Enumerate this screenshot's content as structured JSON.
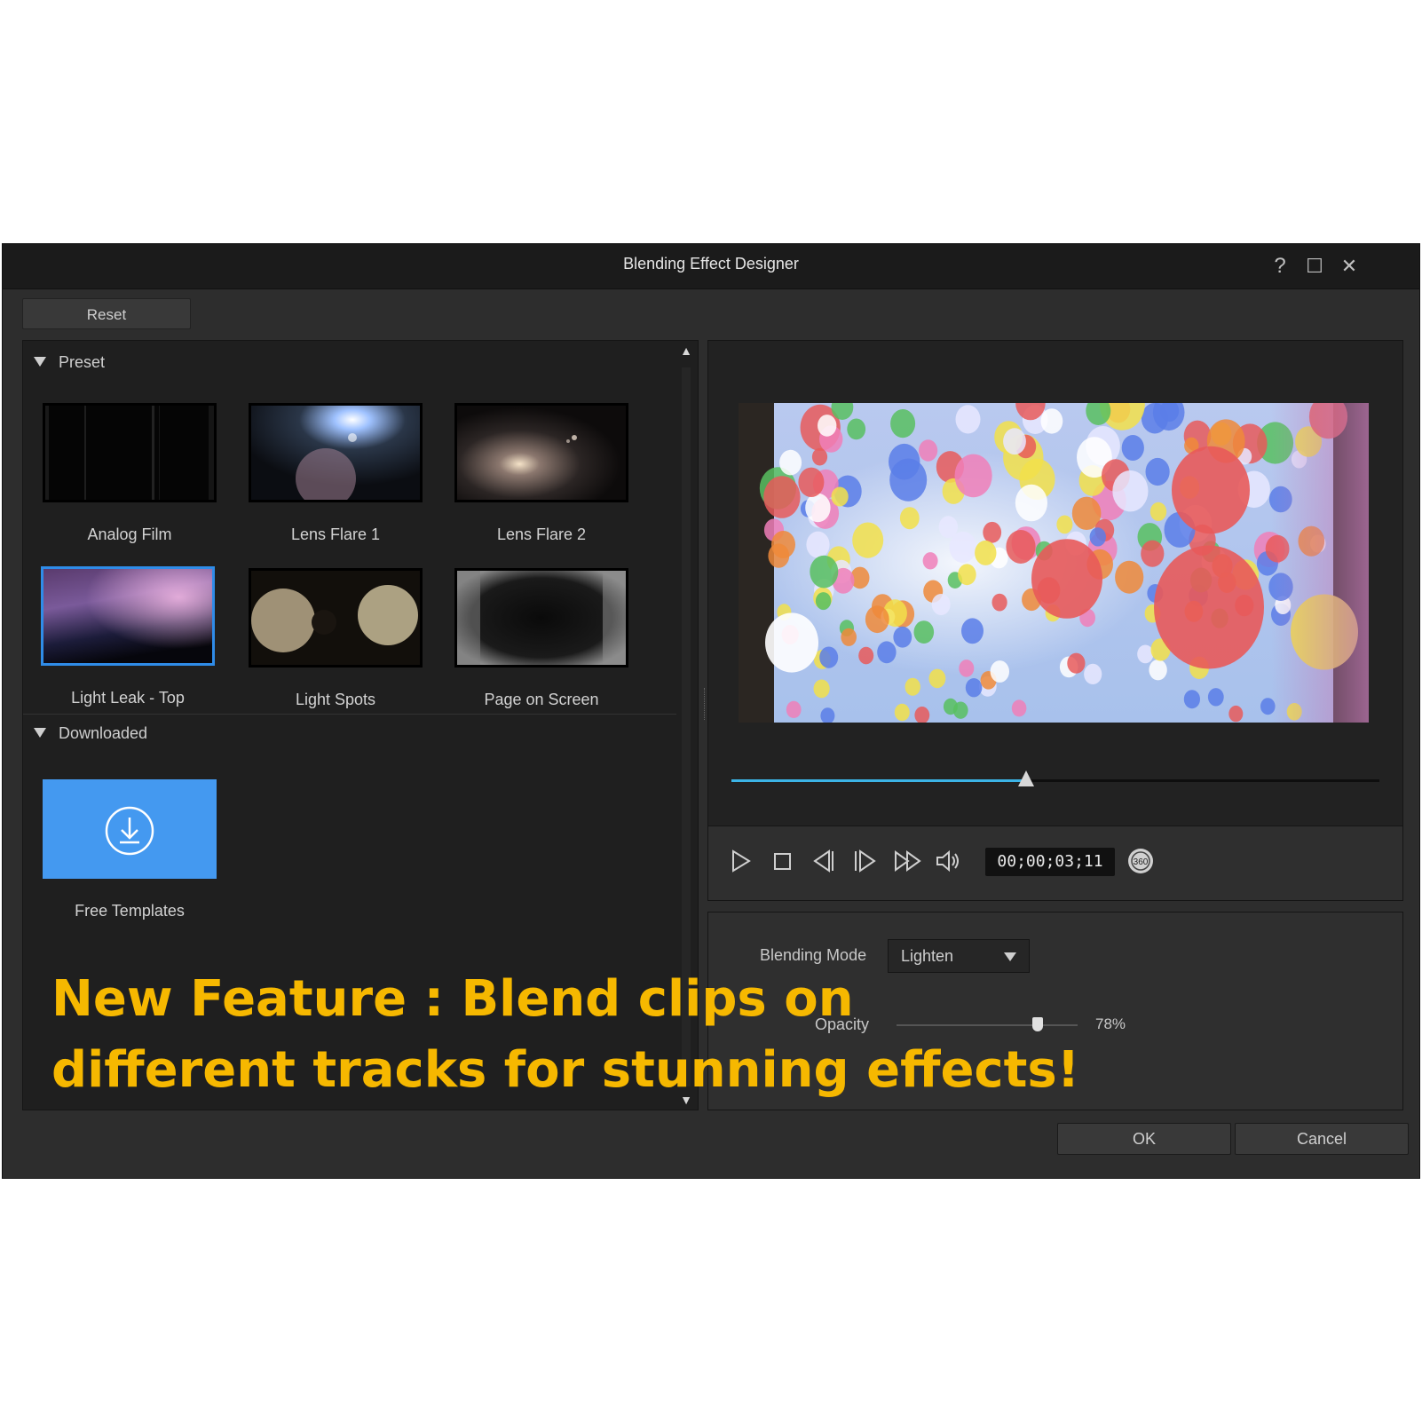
{
  "window": {
    "title": "Blending Effect Designer",
    "help_label": "?",
    "maximize_label": "☐",
    "close_label": "✕"
  },
  "toolbar": {
    "reset_label": "Reset"
  },
  "library": {
    "preset_header": "Preset",
    "presets": [
      {
        "label": "Analog Film"
      },
      {
        "label": "Lens Flare 1"
      },
      {
        "label": "Lens Flare 2"
      },
      {
        "label": "Light Leak - Top",
        "selected": true
      },
      {
        "label": "Light Spots"
      },
      {
        "label": "Page on Screen"
      }
    ],
    "downloaded_header": "Downloaded",
    "downloaded": [
      {
        "label": "Free Templates"
      }
    ],
    "scroll_up": "▲",
    "scroll_down": "▼"
  },
  "player": {
    "progress_fraction": 0.455,
    "timecode": "00;00;03;11",
    "badge_360": "360"
  },
  "settings": {
    "blending_mode_label": "Blending Mode",
    "blending_mode_value": "Lighten",
    "opacity_label": "Opacity",
    "opacity_value": "78%",
    "opacity_fraction": 0.78
  },
  "footer": {
    "ok_label": "OK",
    "cancel_label": "Cancel"
  },
  "promo": {
    "line1": "New Feature : Blend clips on",
    "line2": "different tracks for stunning effects!"
  },
  "colors": {
    "accent": "#3cb4e6",
    "selection": "#2f8ce8",
    "download_tile": "#4499f0",
    "promo_text": "#f6b800"
  }
}
